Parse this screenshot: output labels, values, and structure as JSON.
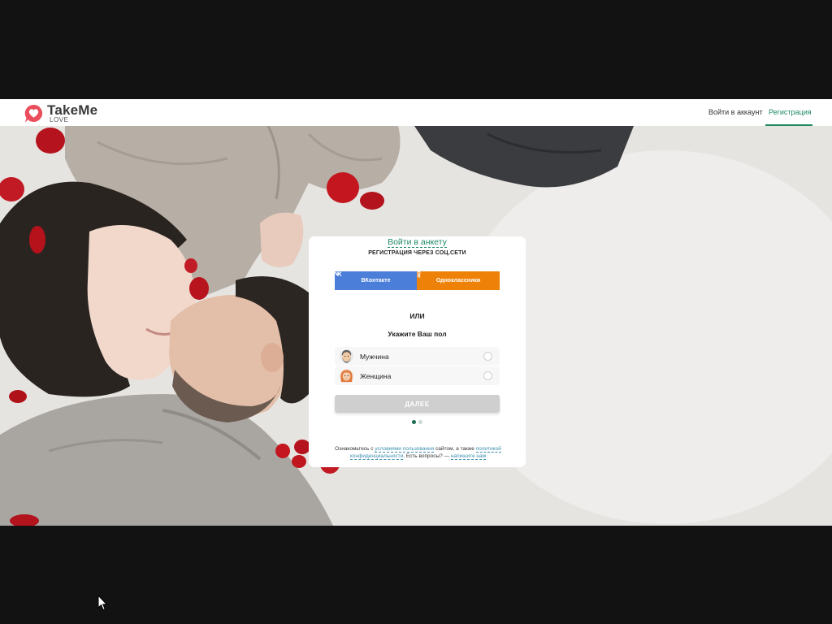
{
  "header": {
    "brand_name": "TakeMe",
    "brand_sub": "LOVE",
    "nav_login": "Войти в аккаунт",
    "nav_register": "Регистрация",
    "accent_color": "#1e8a64",
    "logo_color": "#ea4e5c"
  },
  "card": {
    "login_link": "Войти в анкету",
    "social_title": "РЕГИСТРАЦИЯ ЧЕРЕЗ СОЦ.СЕТИ",
    "vk_label": "ВКонтакте",
    "ok_label": "Одноклассники",
    "vk_color": "#4a7ed9",
    "ok_color": "#ee8208",
    "or_label": "ИЛИ",
    "gender_title": "Укажите Ваш пол",
    "gender_options": [
      {
        "label": "Мужчина",
        "icon": "man-avatar-icon",
        "selected": false
      },
      {
        "label": "Женщина",
        "icon": "woman-avatar-icon",
        "selected": false
      }
    ],
    "next_label": "ДАЛЕЕ",
    "steps": {
      "current": 1,
      "total": 2
    },
    "legal": {
      "t1": "Ознакомьтесь с ",
      "link1": "условиями пользования",
      "t2": " сайтом, а также ",
      "link2": "политикой конфиденциальности",
      "t3": ". Есть вопросы? — ",
      "link3": "напишите нам"
    }
  }
}
